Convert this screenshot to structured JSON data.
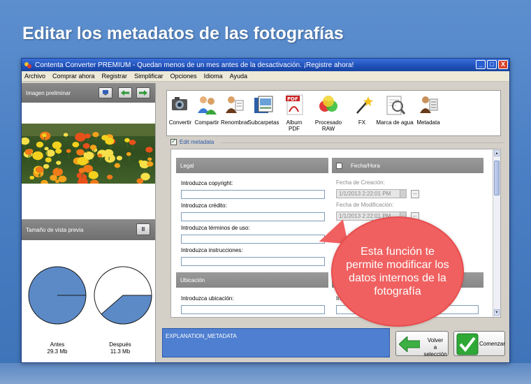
{
  "headline": "Editar los metadatos de las fotografías",
  "window": {
    "title": "Contenta Converter PREMIUM  - Quedan menos de un mes antes de la desactivación. ¡Registre ahora!",
    "buttons": [
      "_",
      "□",
      "X"
    ]
  },
  "menu": [
    "Archivo",
    "Comprar ahora",
    "Registrar",
    "Simplificar",
    "Opciones",
    "Idioma",
    "Ayuda"
  ],
  "left_panel": {
    "preview_title": "Imagen preliminar",
    "size_title": "Tamaño de vista previa",
    "pause_label": "II",
    "before": {
      "label": "Antes",
      "size": "29.3 Mb",
      "fraction": 1.0
    },
    "after": {
      "label": "Después",
      "size": "11.3 Mb",
      "fraction": 0.386
    }
  },
  "toolbar": [
    {
      "label": "Convertir",
      "icon": "convert-icon"
    },
    {
      "label": "Compartir",
      "icon": "share-icon"
    },
    {
      "label": "Renombrar",
      "icon": "rename-icon"
    },
    {
      "label": "Subcarpetas",
      "icon": "subfolders-icon"
    },
    {
      "label": "Album PDF",
      "icon": "pdf-icon"
    },
    {
      "label": "Procesado RAW",
      "icon": "raw-icon"
    },
    {
      "label": "FX",
      "icon": "fx-icon"
    },
    {
      "label": "Marca de agua",
      "icon": "watermark-icon"
    },
    {
      "label": "Metadata",
      "icon": "metadata-icon"
    }
  ],
  "edit_metadata": {
    "label": "Edit metadata",
    "checked": true
  },
  "legal": {
    "header": "Legal",
    "copyright_label": "Introduzca copyright:",
    "credit_label": "Introduzca crédito:",
    "terms_label": "Introduzca términos de uso:",
    "instructions_label": "Introduzca instrucciones:"
  },
  "datetime": {
    "header": "Fecha/Hora",
    "created_label": "Fecha de Creación:",
    "created_value": "1/1/2013 2:22:01 PM",
    "modified_label": "Fecha de Modificación:",
    "modified_value": "1/1/2013 2:22:01 PM",
    "dots": "..."
  },
  "location": {
    "header": "Ubicación",
    "location_label": "Introduzca ubicación:",
    "partial_label": "In"
  },
  "explanation": "EXPLANATION_METADATA",
  "buttons": {
    "back": "Volver\na selección",
    "start": "Comenzar"
  },
  "callout": "Esta función te permite modificar los datos internos de la fotografía"
}
